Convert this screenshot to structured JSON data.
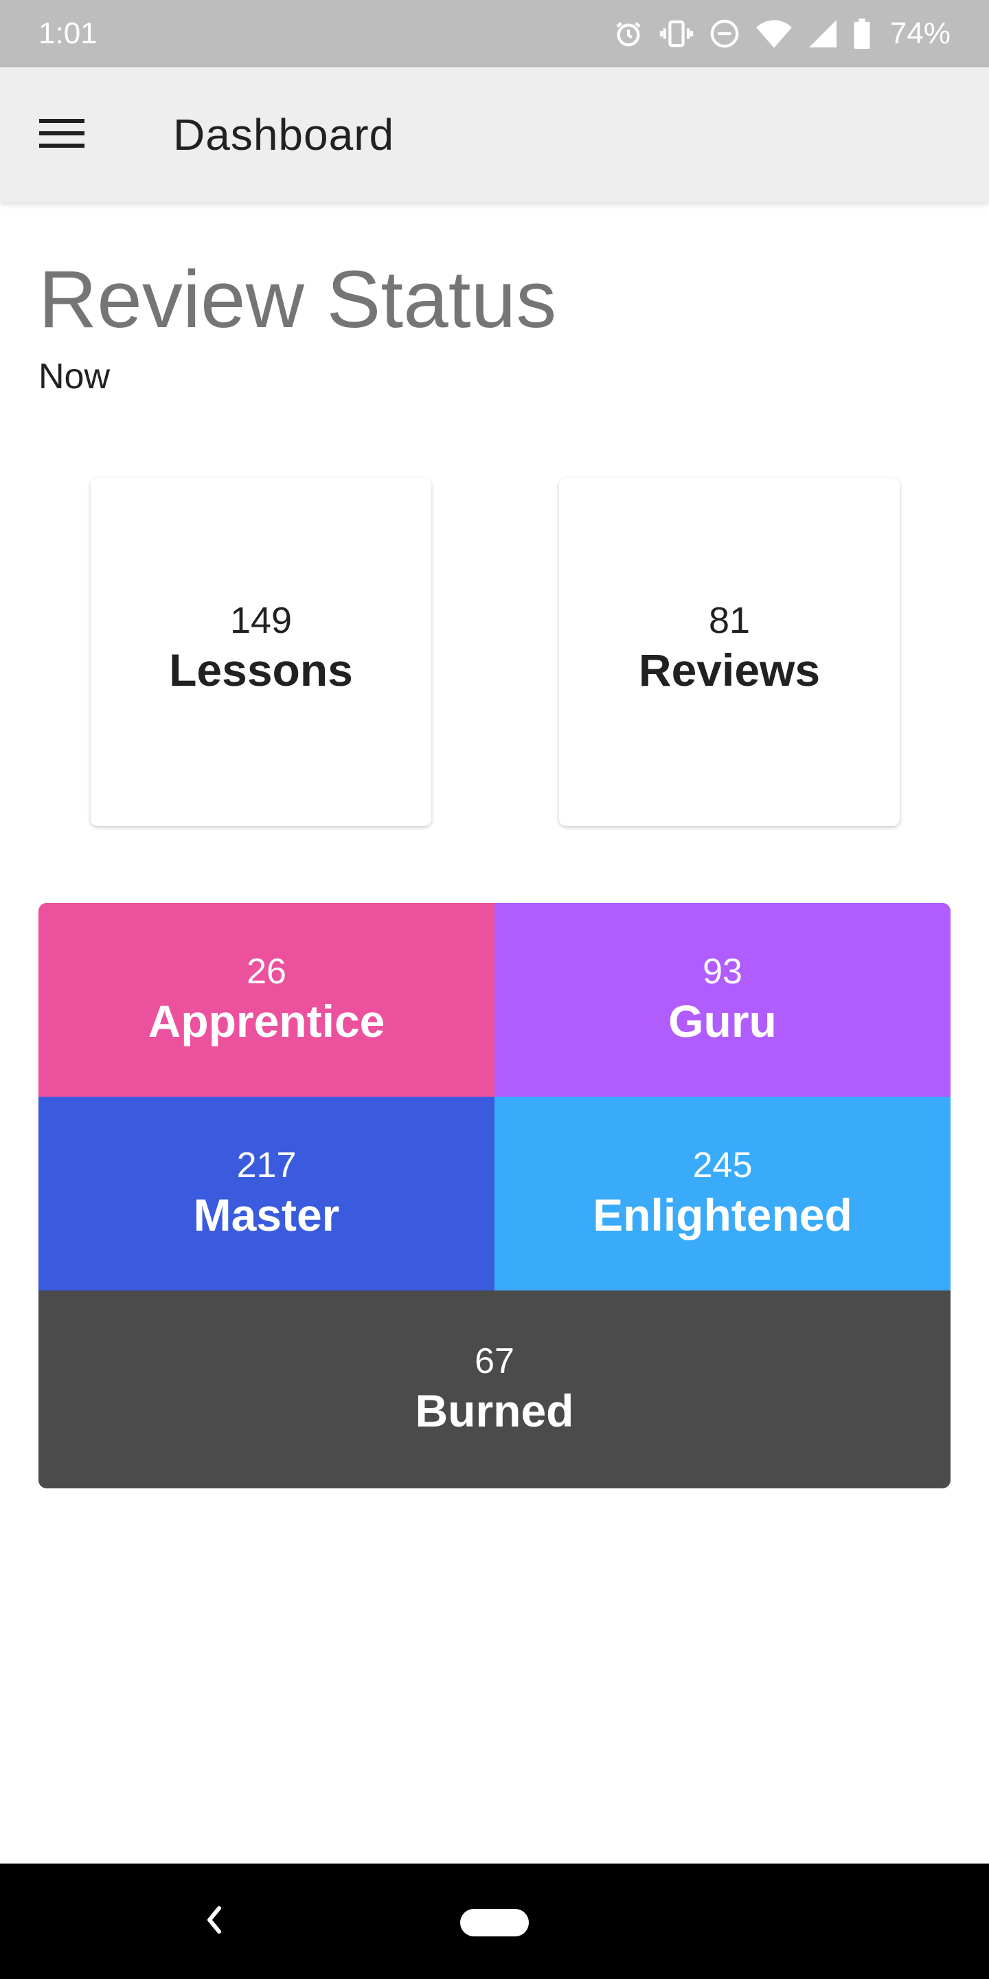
{
  "status_bar": {
    "time": "1:01",
    "battery_percent": "74%",
    "icons": [
      "alarm-icon",
      "vibrate-icon",
      "do-not-disturb-icon",
      "wifi-icon",
      "signal-icon",
      "battery-icon"
    ]
  },
  "app_bar": {
    "title": "Dashboard",
    "menu_icon": "hamburger-menu-icon"
  },
  "review_status": {
    "title": "Review Status",
    "subtitle": "Now",
    "cards": [
      {
        "count": "149",
        "label": "Lessons"
      },
      {
        "count": "81",
        "label": "Reviews"
      }
    ]
  },
  "srs_stages": [
    {
      "count": "26",
      "label": "Apprentice",
      "color": "#ec519d"
    },
    {
      "count": "93",
      "label": "Guru",
      "color": "#b05cfe"
    },
    {
      "count": "217",
      "label": "Master",
      "color": "#3a5bdd"
    },
    {
      "count": "245",
      "label": "Enlightened",
      "color": "#3aabfb"
    },
    {
      "count": "67",
      "label": "Burned",
      "color": "#4b4b4b"
    }
  ],
  "nav_bar": {
    "back_icon": "back-chevron-icon",
    "home_icon": "home-pill-icon"
  }
}
